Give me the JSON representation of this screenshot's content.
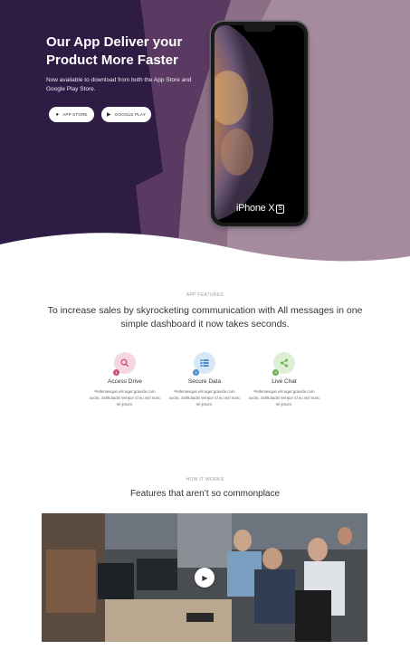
{
  "hero": {
    "title": "Our App Deliver your Product More Faster",
    "subtitle": "Now available to download from both the App Store and Google Play Store.",
    "app_store_label": "APP STORE",
    "google_play_label": "GOOGLE PLAY",
    "phone_brand": "iPhone X",
    "phone_brand_badge": "S",
    "colors": {
      "dark": "#2f1c45",
      "mid": "#5a3a62",
      "light": "#8c6f87",
      "lightest": "#a48b9e"
    }
  },
  "features_section": {
    "label": "APP FEATURES",
    "headline": "To increase sales by skyrocketing communication with All messages in one simple dashboard it now takes seconds.",
    "items": [
      {
        "number": "1",
        "title": "Access Drive",
        "description": "Pellentesque elit eget gravida cum sociis. Sollicitudin tempor id eu nisl nunc mi ipsum.",
        "icon": "search-icon",
        "bg": "#f4d7e2",
        "accent": "#d24a79"
      },
      {
        "number": "2",
        "title": "Secure Data",
        "description": "Pellentesque elit eget gravida cum sociis. Sollicitudin tempor id eu nisl nunc mi ipsum.",
        "icon": "list-icon",
        "bg": "#d6e6f5",
        "accent": "#4a8ccc"
      },
      {
        "number": "3",
        "title": "Live Chat",
        "description": "Pellentesque elit eget gravida cum sociis. Sollicitudin tempor id eu nisl nunc mi ipsum.",
        "icon": "share-icon",
        "bg": "#dcefd3",
        "accent": "#6cb04f"
      }
    ]
  },
  "how_it_works": {
    "label": "HOW IT WORKS",
    "title": "Features that aren’t so commonplace",
    "play_icon": "play-icon"
  }
}
